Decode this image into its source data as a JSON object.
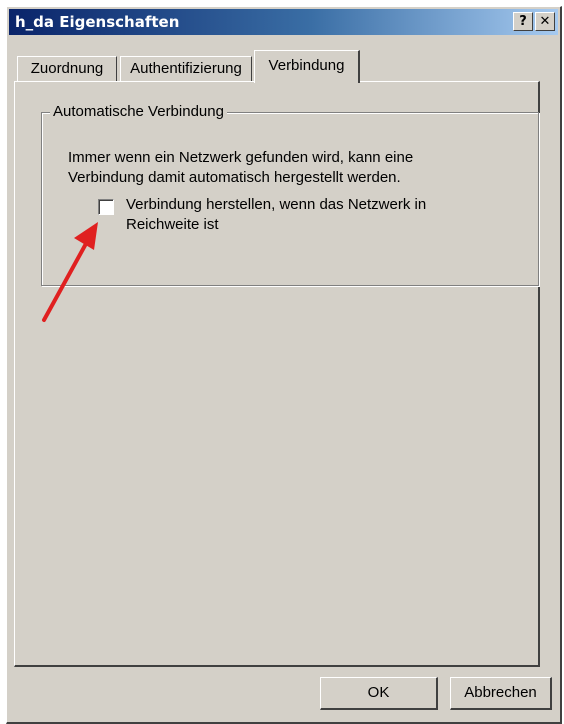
{
  "window": {
    "title": "h_da Eigenschaften",
    "help_label": "?",
    "close_label": "✕"
  },
  "tabs": [
    {
      "label": "Zuordnung",
      "active": false
    },
    {
      "label": "Authentifizierung",
      "active": false
    },
    {
      "label": "Verbindung",
      "active": true
    }
  ],
  "group": {
    "legend": "Automatische Verbindung",
    "description": "Immer wenn ein Netzwerk gefunden wird, kann eine Verbindung damit automatisch hergestellt werden.",
    "checkbox_label": "Verbindung herstellen, wenn das Netzwerk in Reichweite ist",
    "checkbox_checked": false
  },
  "annotation": {
    "arrow_color": "#e02020"
  },
  "buttons": {
    "ok_label": "OK",
    "cancel_label": "Abbrechen"
  }
}
